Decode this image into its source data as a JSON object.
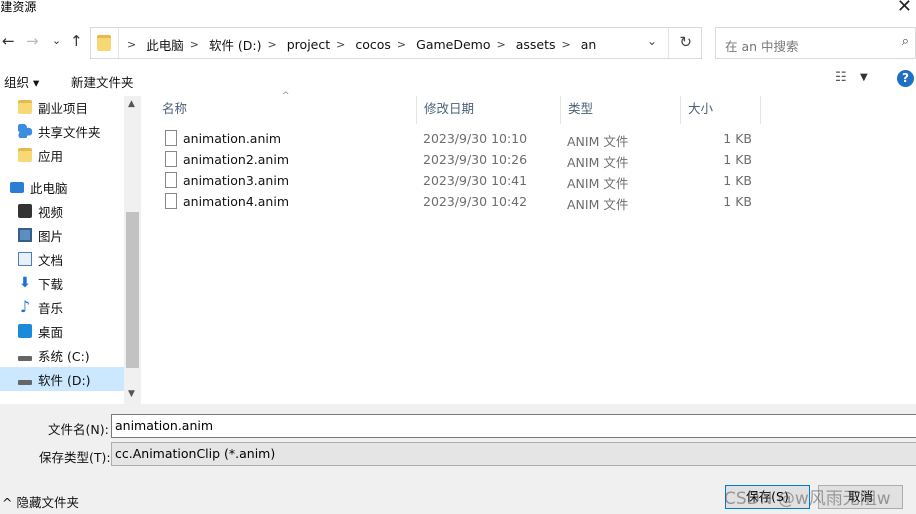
{
  "window": {
    "title": "l建资源",
    "close": "✕"
  },
  "nav_buttons": {
    "back": "←",
    "forward": "→",
    "recent": "⌄",
    "up": "↑"
  },
  "address": {
    "crumbs": [
      "此电脑",
      "软件 (D:)",
      "project",
      "cocos",
      "GameDemo",
      "assets",
      "an"
    ],
    "dropdown": "⌄",
    "refresh": "↻"
  },
  "search": {
    "placeholder": "在 an 中搜索",
    "icon": "⌕"
  },
  "toolbar": {
    "organize": "组织 ▾",
    "new_folder": "新建文件夹",
    "view": "☷",
    "view_drop": "▼",
    "help": "?"
  },
  "sidebar": {
    "items": [
      {
        "label": "副业项目",
        "icon": "folder-icon"
      },
      {
        "label": "共享文件夹",
        "icon": "share-icon"
      },
      {
        "label": "应用",
        "icon": "folder-icon"
      },
      {
        "label": "此电脑",
        "icon": "pc-icon"
      },
      {
        "label": "视频",
        "icon": "video-icon"
      },
      {
        "label": "图片",
        "icon": "pictures-icon"
      },
      {
        "label": "文档",
        "icon": "documents-icon"
      },
      {
        "label": "下载",
        "icon": "download-icon"
      },
      {
        "label": "音乐",
        "icon": "music-icon"
      },
      {
        "label": "桌面",
        "icon": "desktop-icon"
      },
      {
        "label": "系统 (C:)",
        "icon": "drive-icon"
      },
      {
        "label": "软件 (D:)",
        "icon": "drive-icon",
        "selected": true
      }
    ],
    "scroll_up": "▲",
    "scroll_down": "▼"
  },
  "columns": {
    "name": "名称",
    "date": "修改日期",
    "type": "类型",
    "size": "大小",
    "sort_arrow": "^"
  },
  "files": [
    {
      "name": "animation.anim",
      "date": "2023/9/30 10:10",
      "type": "ANIM 文件",
      "size": "1 KB"
    },
    {
      "name": "animation2.anim",
      "date": "2023/9/30 10:26",
      "type": "ANIM 文件",
      "size": "1 KB"
    },
    {
      "name": "animation3.anim",
      "date": "2023/9/30 10:41",
      "type": "ANIM 文件",
      "size": "1 KB"
    },
    {
      "name": "animation4.anim",
      "date": "2023/9/30 10:42",
      "type": "ANIM 文件",
      "size": "1 KB"
    }
  ],
  "form": {
    "filename_label": "文件名(N):",
    "filename_value": "animation.anim",
    "filetype_label": "保存类型(T):",
    "filetype_value": "cc.AnimationClip (*.anim)",
    "hide_folders": "^ 隐藏文件夹",
    "save": "保存(S)",
    "cancel": "取消"
  },
  "watermark": "CSDN @w风雨无阻w"
}
